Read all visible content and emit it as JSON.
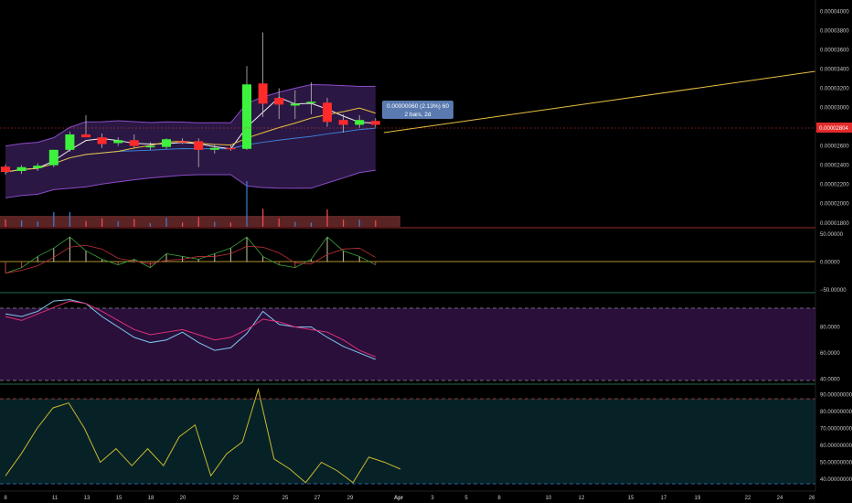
{
  "chart_data": [
    {
      "type": "candlestick",
      "panel": "price",
      "x_labels": [
        "8",
        "11",
        "13",
        "15",
        "18",
        "20",
        "22",
        "25",
        "27",
        "29",
        "Apr",
        "3",
        "5",
        "8",
        "10",
        "12",
        "15",
        "17",
        "19",
        "22",
        "24",
        "26"
      ],
      "y_ticks": [
        "0.00004000",
        "0.00003800",
        "0.00003600",
        "0.00003400",
        "0.00003200",
        "0.00003000",
        "0.00002800",
        "0.00002600",
        "0.00002400",
        "0.00002200",
        "0.00002000",
        "0.00001800"
      ],
      "ylim": [
        1.76e-05,
        4.06e-05
      ],
      "grid": false,
      "candles": [
        {
          "o": 2.385e-05,
          "h": 2.41e-05,
          "l": 2.3e-05,
          "c": 2.33e-05
        },
        {
          "o": 2.34e-05,
          "h": 2.4e-05,
          "l": 2.31e-05,
          "c": 2.38e-05
        },
        {
          "o": 2.37e-05,
          "h": 2.42e-05,
          "l": 2.34e-05,
          "c": 2.395e-05
        },
        {
          "o": 2.4e-05,
          "h": 2.56e-05,
          "l": 2.38e-05,
          "c": 2.56e-05
        },
        {
          "o": 2.56e-05,
          "h": 2.75e-05,
          "l": 2.54e-05,
          "c": 2.72e-05
        },
        {
          "o": 2.72e-05,
          "h": 2.92e-05,
          "l": 2.69e-05,
          "c": 2.69e-05
        },
        {
          "o": 2.69e-05,
          "h": 2.73e-05,
          "l": 2.58e-05,
          "c": 2.62e-05
        },
        {
          "o": 2.63e-05,
          "h": 2.69e-05,
          "l": 2.6e-05,
          "c": 2.66e-05
        },
        {
          "o": 2.66e-05,
          "h": 2.72e-05,
          "l": 2.58e-05,
          "c": 2.6e-05
        },
        {
          "o": 2.6e-05,
          "h": 2.64e-05,
          "l": 2.56e-05,
          "c": 2.6e-05
        },
        {
          "o": 2.59e-05,
          "h": 2.68e-05,
          "l": 2.57e-05,
          "c": 2.67e-05
        },
        {
          "o": 2.65e-05,
          "h": 2.68e-05,
          "l": 2.62e-05,
          "c": 2.64e-05
        },
        {
          "o": 2.65e-05,
          "h": 2.68e-05,
          "l": 2.38e-05,
          "c": 2.56e-05
        },
        {
          "o": 2.56e-05,
          "h": 2.62e-05,
          "l": 2.52e-05,
          "c": 2.58e-05
        },
        {
          "o": 2.58e-05,
          "h": 2.61e-05,
          "l": 2.55e-05,
          "c": 2.57e-05
        },
        {
          "o": 2.57e-05,
          "h": 3.43e-05,
          "l": 2.56e-05,
          "c": 3.24e-05
        },
        {
          "o": 3.25e-05,
          "h": 3.78e-05,
          "l": 2.9e-05,
          "c": 3.04e-05
        },
        {
          "o": 3.1e-05,
          "h": 3.2e-05,
          "l": 2.88e-05,
          "c": 3.03e-05
        },
        {
          "o": 3.02e-05,
          "h": 3.18e-05,
          "l": 2.88e-05,
          "c": 3.04e-05
        },
        {
          "o": 3.05e-05,
          "h": 3.26e-05,
          "l": 2.93e-05,
          "c": 3.06e-05
        },
        {
          "o": 3.05e-05,
          "h": 3.1e-05,
          "l": 2.8e-05,
          "c": 2.85e-05
        },
        {
          "o": 2.87e-05,
          "h": 2.93e-05,
          "l": 2.74e-05,
          "c": 2.82e-05
        },
        {
          "o": 2.82e-05,
          "h": 2.92e-05,
          "l": 2.79e-05,
          "c": 2.87e-05
        },
        {
          "o": 2.86e-05,
          "h": 2.89e-05,
          "l": 2.79e-05,
          "c": 2.82e-05
        }
      ],
      "last_price": "0.00002804",
      "tooltip": {
        "line1": "0.00000060 (2.13%) 60",
        "line2": "2 bars, 2d"
      }
    },
    {
      "type": "bar",
      "panel": "macd",
      "y_ticks": [
        "50.00000",
        "0.00000",
        "−50.00000"
      ],
      "ylim": [
        -55,
        60
      ],
      "values": [
        -20,
        -10,
        10,
        25,
        45,
        20,
        5,
        -5,
        5,
        -10,
        15,
        10,
        5,
        15,
        25,
        45,
        10,
        -5,
        -10,
        5,
        45,
        20,
        10,
        -5
      ]
    },
    {
      "type": "line",
      "panel": "stochastic",
      "y_ticks": [
        "80.0000",
        "60.0000",
        "40.0000"
      ],
      "ylim": [
        36,
        105
      ],
      "series": [
        {
          "values": [
            90,
            88,
            92,
            100,
            101,
            98,
            88,
            80,
            72,
            68,
            70,
            76,
            68,
            62,
            64,
            75,
            92,
            82,
            80,
            80,
            72,
            65,
            60,
            55
          ]
        },
        {
          "values": [
            88,
            85,
            90,
            95,
            100,
            98,
            92,
            85,
            78,
            74,
            76,
            78,
            74,
            70,
            72,
            78,
            86,
            84,
            80,
            78,
            76,
            70,
            62,
            57
          ]
        }
      ],
      "bands": [
        87,
        50
      ]
    },
    {
      "type": "line",
      "panel": "rsi",
      "y_ticks": [
        "90.00000000",
        "80.00000000",
        "70.00000000",
        "60.00000000",
        "50.00000000",
        "40.00000000"
      ],
      "ylim": [
        33,
        95
      ],
      "values": [
        42,
        55,
        70,
        82,
        85,
        70,
        50,
        58,
        48,
        58,
        48,
        65,
        72,
        42,
        55,
        62,
        93,
        52,
        46,
        38,
        50,
        45,
        38,
        53,
        50,
        46
      ],
      "bands": [
        86,
        36
      ]
    }
  ]
}
